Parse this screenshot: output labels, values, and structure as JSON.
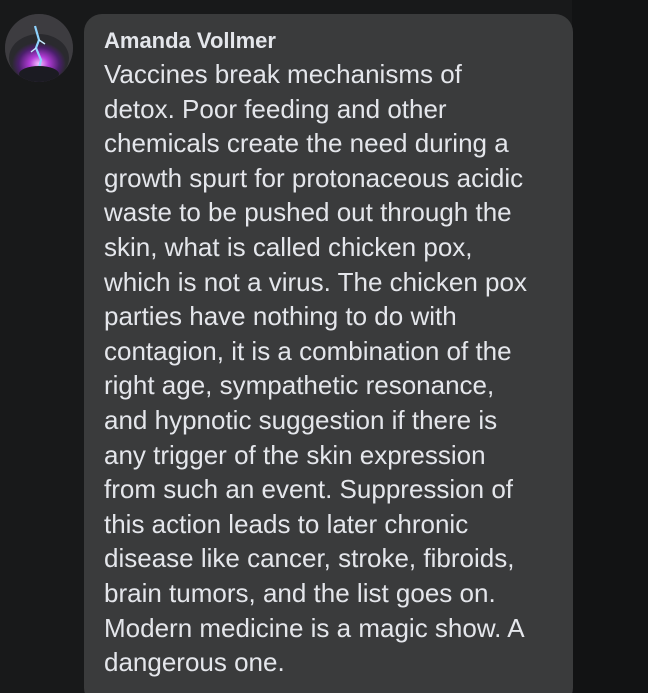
{
  "comment": {
    "author": "Amanda Vollmer",
    "avatar_icon": "profile-avatar",
    "text": "Vaccines break mechanisms of\ndetox. Poor feeding and other\nchemicals create the need during a\ngrowth spurt for protonaceous acidic\nwaste to be pushed out through the\nskin, what is called chicken pox,\nwhich is not a virus. The chicken pox\nparties have nothing to do with\ncontagion, it is a combination of the\nright age, sympathetic resonance,\nand hypnotic suggestion if there is\nany trigger of the skin expression\nfrom such an event. Suppression of\nthis action leads to later chronic\ndisease like cancer, stroke, fibroids,\nbrain tumors, and the list goes on.\nModern medicine is a magic show. A\ndangerous one."
  },
  "colors": {
    "background": "#18191a",
    "bubble": "#3a3b3c",
    "text": "#e4e6eb"
  }
}
